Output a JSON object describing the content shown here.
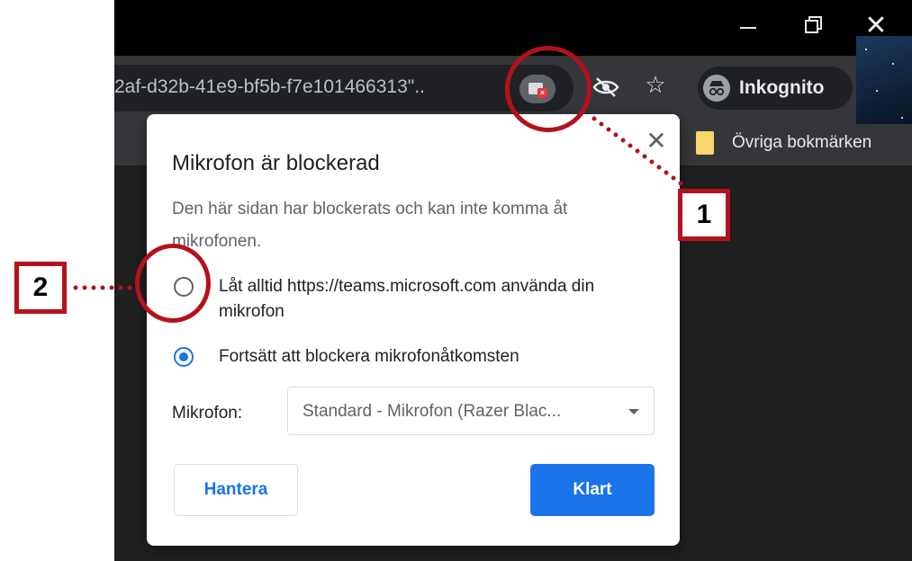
{
  "browser": {
    "url_fragment": "2af-d32b-41e9-bf5b-f7e101466313\"..",
    "incognito_label": "Inkognito",
    "bookmark_folder": "Övriga bokmärken",
    "window_controls": {
      "minimize_icon": "minimize-icon",
      "restore_icon": "restore-icon",
      "close_glyph": "✕"
    },
    "star_glyph": "☆"
  },
  "dialog": {
    "title": "Mikrofon är blockerad",
    "description": "Den här sidan har blockerats och kan inte komma åt mikrofonen.",
    "option_allow": "Låt alltid https://teams.microsoft.com använda din mikrofon",
    "option_block": "Fortsätt att blockera mikrofonåtkomsten",
    "selected_option": "option_block",
    "mic_label": "Mikrofon:",
    "mic_value": "Standard - Mikrofon (Razer Blac...",
    "manage_button": "Hantera",
    "done_button": "Klart",
    "close_glyph": "✕"
  },
  "annotations": {
    "marker_1": "1",
    "marker_2": "2",
    "color": "#b3121b"
  },
  "colors": {
    "accent": "#1a73e8",
    "chrome_dark": "#202124",
    "toolbar": "#35363a"
  }
}
